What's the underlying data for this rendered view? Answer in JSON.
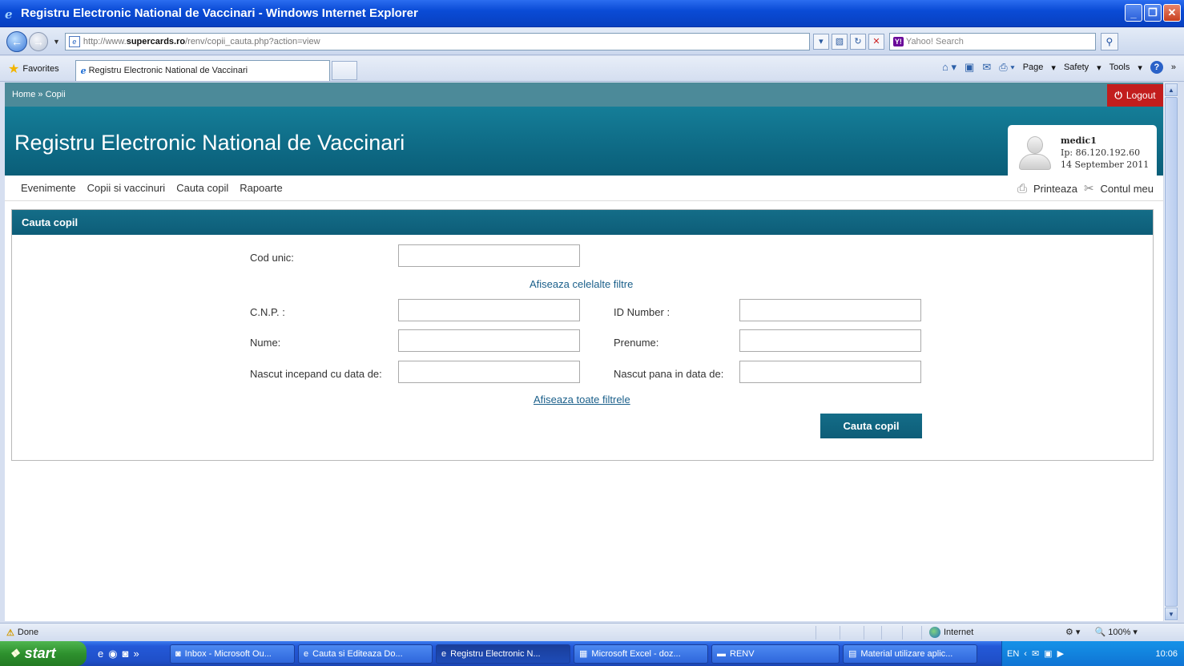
{
  "window": {
    "title": "Registru Electronic National de Vaccinari - Windows Internet Explorer"
  },
  "browser": {
    "url_prefix": "http://www.",
    "url_domain": "supercards.ro",
    "url_path": "/renv/copii_cauta.php?action=view",
    "search_placeholder": "Yahoo! Search",
    "favorites_label": "Favorites",
    "tab_title": "Registru Electronic National de Vaccinari",
    "cmd_page": "Page",
    "cmd_safety": "Safety",
    "cmd_tools": "Tools"
  },
  "site": {
    "breadcrumb": "Home » Copii",
    "logout": "Logout",
    "title": "Registru Electronic National de Vaccinari",
    "user": {
      "name": "medic1",
      "ip": "Ip: 86.120.192.60",
      "date": "14 September 2011"
    },
    "menu": [
      "Evenimente",
      "Copii si vaccinuri",
      "Cauta copil",
      "Rapoarte"
    ],
    "menu_right": {
      "print": "Printeaza",
      "account": "Contul meu"
    }
  },
  "search_panel": {
    "heading": "Cauta copil",
    "cod_unic_label": "Cod unic:",
    "show_other_filters": "Afiseaza celelalte filtre",
    "cnp_label": "C.N.P. :",
    "id_number_label": "ID Number :",
    "nume_label": "Nume:",
    "prenume_label": "Prenume:",
    "born_from_label": "Nascut incepand cu data de:",
    "born_until_label": "Nascut pana in data de:",
    "show_all_filters": "Afiseaza toate filtrele",
    "search_button": "Cauta copil",
    "values": {
      "cod_unic": "",
      "cnp": "",
      "id_number": "",
      "nume": "",
      "prenume": "",
      "born_from": "",
      "born_until": ""
    }
  },
  "statusbar": {
    "status": "Done",
    "zone": "Internet",
    "zoom": "100%"
  },
  "taskbar": {
    "start": "start",
    "tasks": [
      "Inbox - Microsoft Ou...",
      "Cauta si Editeaza Do...",
      "Registru Electronic N...",
      "Microsoft Excel - doz...",
      "RENV",
      "Material utilizare aplic..."
    ],
    "lang": "EN",
    "clock": "10:06"
  },
  "colors": {
    "teal_header": "#0e6a85",
    "strip": "#4c8a99",
    "logout_red": "#c21d1d",
    "link": "#1a5f8a"
  }
}
